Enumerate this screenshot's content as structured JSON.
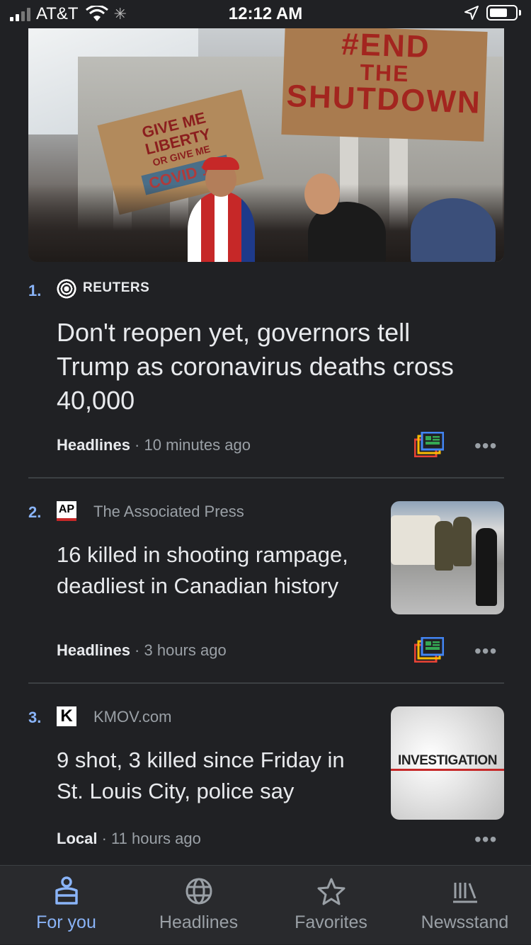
{
  "status_bar": {
    "carrier": "AT&T",
    "time": "12:12 AM"
  },
  "stories": [
    {
      "rank": "1.",
      "source": "REUTERS",
      "headline": "Don't reopen yet, governors tell Trump as coronavirus deaths cross 40,000",
      "category": "Headlines",
      "time": "10 minutes ago",
      "image": {
        "sign_left_lines": [
          "GIVE ME",
          "LIBERTY",
          "OR GIVE ME",
          "COVID 19!"
        ],
        "sign_right_lines": [
          "#END",
          "THE",
          "SHUTDOWN"
        ]
      }
    },
    {
      "rank": "2.",
      "source_logo": "AP",
      "source": "The Associated Press",
      "headline": "16 killed in shooting rampage, deadliest in Canadian history",
      "category": "Headlines",
      "time": "3 hours ago"
    },
    {
      "rank": "3.",
      "source_logo": "K",
      "source": "KMOV.com",
      "headline": "9 shot, 3 killed since Friday in St. Louis City, police say",
      "category": "Local",
      "time": "11 hours ago",
      "thumb_text": "INVESTIGATION"
    }
  ],
  "separator": " · ",
  "more_glyph": "•••",
  "bottom_nav": [
    {
      "label": "For you",
      "icon": "for-you-icon",
      "active": true
    },
    {
      "label": "Headlines",
      "icon": "globe-icon",
      "active": false
    },
    {
      "label": "Favorites",
      "icon": "star-icon",
      "active": false
    },
    {
      "label": "Newsstand",
      "icon": "newsstand-icon",
      "active": false
    }
  ],
  "colors": {
    "background": "#202124",
    "accent": "#8ab4f8",
    "text_primary": "#e8eaed",
    "text_secondary": "#9aa0a6"
  }
}
